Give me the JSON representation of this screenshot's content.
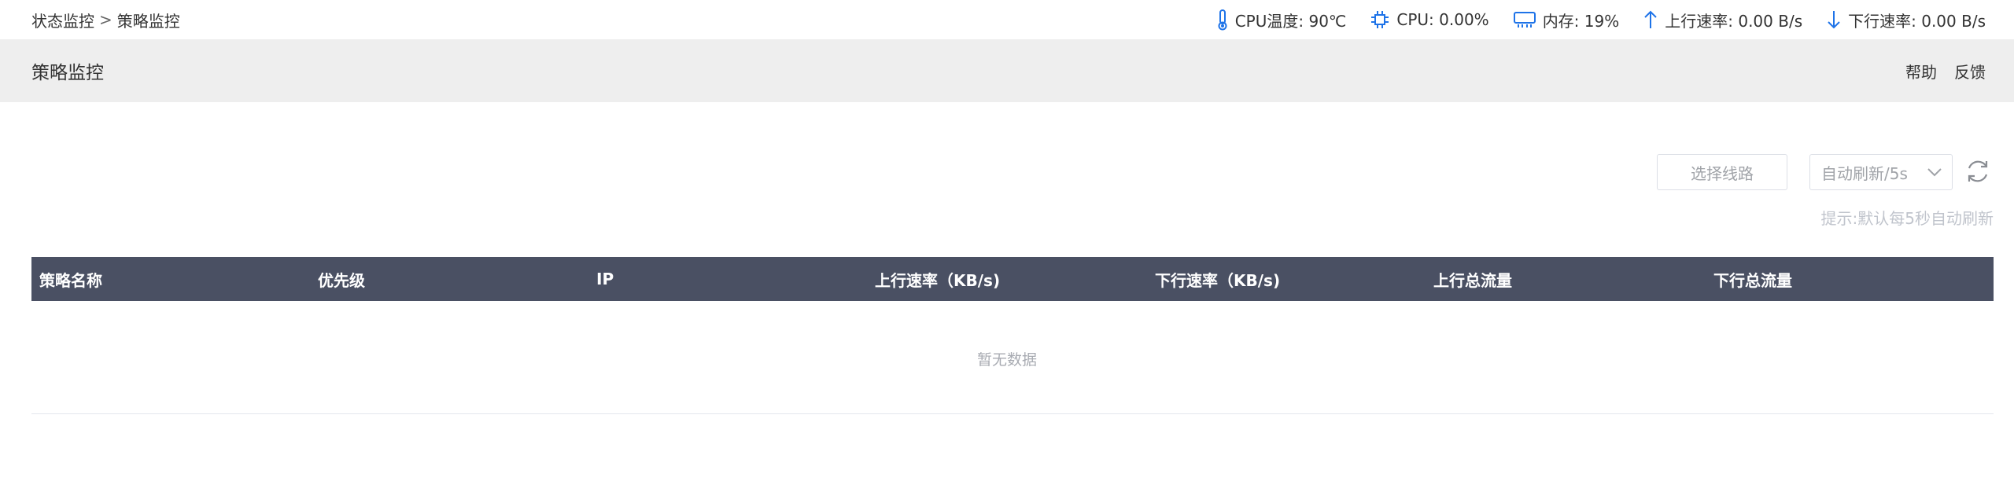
{
  "breadcrumb": {
    "parent": "状态监控",
    "separator": ">",
    "current": "策略监控"
  },
  "status": {
    "cpu_temp": "CPU温度: 90℃",
    "cpu_usage": "CPU: 0.00%",
    "memory": "内存: 19%",
    "upload_rate": "上行速率: 0.00 B/s",
    "download_rate": "下行速率: 0.00 B/s",
    "accent_color": "#1e73e8"
  },
  "titlebar": {
    "title": "策略监控",
    "help": "帮助",
    "feedback": "反馈"
  },
  "controls": {
    "select_route": "选择线路",
    "refresh_interval": "自动刷新/5s",
    "hint": "提示:默认每5秒自动刷新"
  },
  "table": {
    "header_color": "#4a5063",
    "columns": [
      "策略名称",
      "优先级",
      "IP",
      "上行速率（KB/s)",
      "下行速率（KB/s)",
      "上行总流量",
      "下行总流量"
    ],
    "rows": [],
    "empty_text": "暂无数据"
  }
}
